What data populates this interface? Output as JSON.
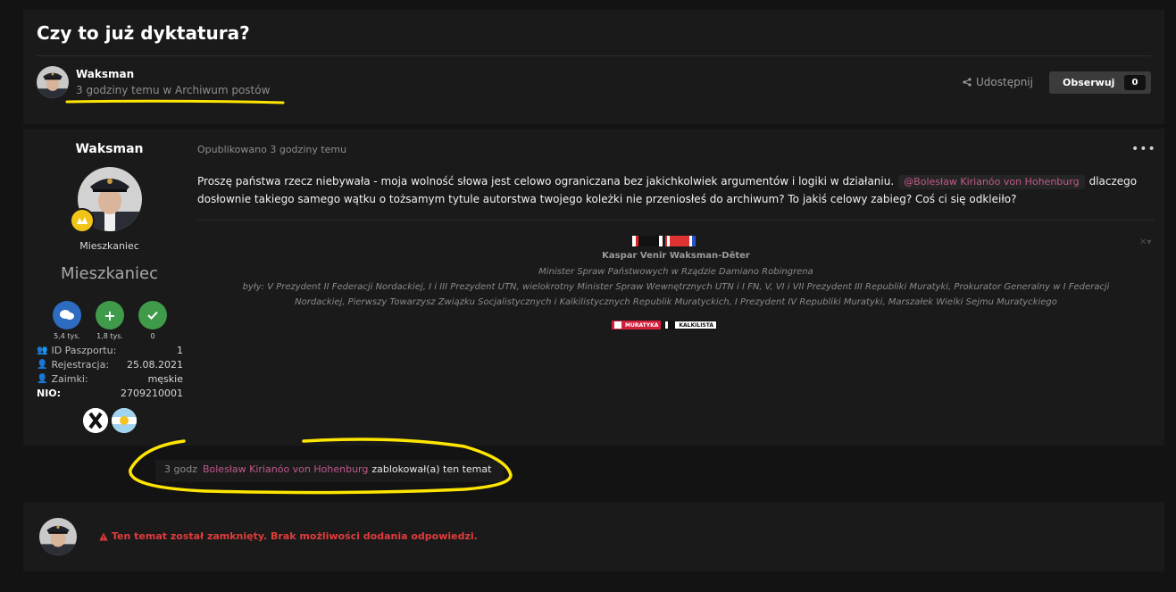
{
  "topic": {
    "title": "Czy to już dyktatura?",
    "author": "Waksman",
    "meta": "3 godziny temu w Archiwum postów",
    "share_label": "Udostępnij",
    "follow_label": "Obserwuj",
    "follow_count": "0"
  },
  "author_panel": {
    "name": "Waksman",
    "rank_small": "Mieszkaniec",
    "rank_big": "Mieszkaniec",
    "stats": [
      {
        "icon": "comments-icon",
        "value": "5,4 tys."
      },
      {
        "icon": "plus-icon",
        "value": "1,8 tys."
      },
      {
        "icon": "check-icon",
        "value": "0"
      }
    ],
    "fields": [
      {
        "label": "ID Paszportu:",
        "value": "1"
      },
      {
        "label": "Rejestracja:",
        "value": "25.08.2021"
      },
      {
        "label": "Zaimki:",
        "value": "męskie"
      },
      {
        "label": "NIO:",
        "value": "2709210001"
      }
    ]
  },
  "post": {
    "posted": "Opublikowano 3 godziny temu",
    "text_1": "Proszę państwa rzecz niebywała - moja wolność słowa jest celowo ograniczana bez jakichkolwiek argumentów i logiki w działaniu.",
    "mention": "@Bolesław Kirianóo von Hohenburg",
    "text_2": "dlaczego dosłownie takiego samego wątku o tożsamym tytule autorstwa twojego koleżki nie przeniosłeś do archiwum? To jakiś celowy zabieg? Coś ci się odkleiło?"
  },
  "signature": {
    "name": "Kaspar Venir Waksman-Děter",
    "line1": "Minister Spraw Państwowych w Rządzie Damiano Robingrena",
    "line2": "były: V Prezydent II Federacji Nordackiej, I i III Prezydent UTN, wielokrotny Minister Spraw Wewnętrznych UTN i I FN, V, VI i VII Prezydent III Republiki Muratyki, Prokurator Generalny w I Federacji",
    "line3": "Nordackiej, Pierwszy Towarzysz Związku Socjalistycznych i Kalkilistycznych Republik Muratyckich, I Prezydent IV Republiki Muratyki, Marszałek Wielki Sejmu Muratyckiego",
    "badge1": "MURATYKA",
    "badge2": "KALKILISTA",
    "close": "✕▾"
  },
  "event": {
    "time": "3 godz",
    "user": "Bolesław Kirianóo von Hohenburg",
    "action": "zablokował(a) ten temat"
  },
  "closed": {
    "message": "Ten temat został zamknięty. Brak możliwości dodania odpowiedzi."
  },
  "colors": {
    "background": "#131313",
    "panel": "#1a1a1a",
    "mention": "#c05a8c",
    "error": "#e03c3c",
    "highlight": "#ffe600"
  }
}
